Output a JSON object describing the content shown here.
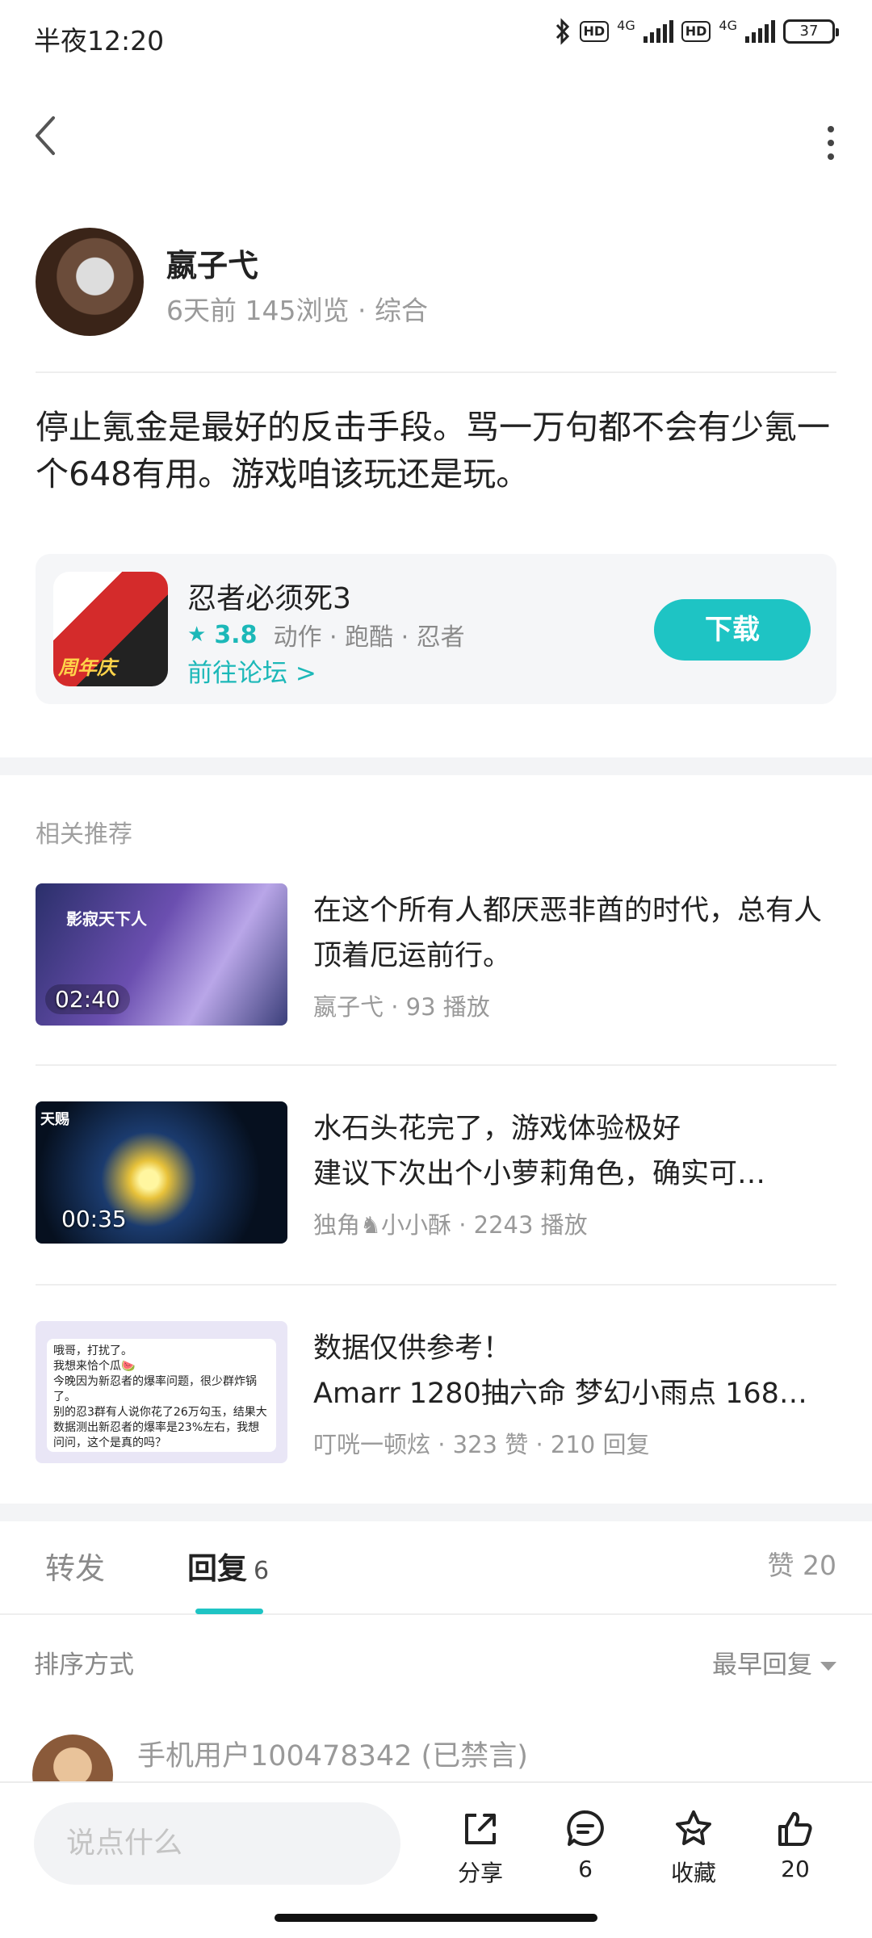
{
  "status_bar": {
    "time": "半夜12:20",
    "hd1": "HD",
    "net1": "4G",
    "hd2": "HD",
    "net2": "4G",
    "battery": "37"
  },
  "author": {
    "name": "嬴子弋",
    "meta": "6天前 145浏览 · 综合"
  },
  "post": {
    "text": "停止氪金是最好的反击手段。骂一万句都不会有少氪一个648有用。游戏咱该玩还是玩。"
  },
  "game_card": {
    "icon_badge": "周年庆",
    "name": "忍者必须死3",
    "rating": "3.8",
    "tags": "动作 · 跑酷 · 忍者",
    "forum_link": "前往论坛 >",
    "download_label": "下载"
  },
  "recommendations": {
    "title": "相关推荐",
    "items": [
      {
        "text": "在这个所有人都厌恶非酋的时代，总有人顶着厄运前行。",
        "meta": "嬴子弋 · 93 播放",
        "duration": "02:40",
        "thumb_title": "影寂天下人"
      },
      {
        "text": "水石头花完了，游戏体验极好\n建议下次出个小萝莉角色，确实可…",
        "meta": "独角♞小小酥 · 2243 播放",
        "duration": "00:35",
        "thumb_title": "天赐"
      },
      {
        "text": "数据仅供参考！\nAmarr 1280抽六命 梦幻小雨点 168…",
        "meta": "叮咣一顿炫 · 323 赞 · 210 回复",
        "duration": "",
        "thumb_title": "哦哥，打扰了。\n我想来恰个瓜🍉\n今晚因为新忍者的爆率问题，很少群炸锅了。\n别的忍3群有人说你花了26万勾玉，结果大数据测出新忍者的爆率是23%左右，我想问问，这个是真的吗？"
      }
    ]
  },
  "tabs": {
    "forward": "转发",
    "reply": "回复",
    "reply_count": "6",
    "likes": "赞 20"
  },
  "sort": {
    "label": "排序方式",
    "value": "最早回复"
  },
  "reply_preview": {
    "user": "手机用户100478342 (已禁言)"
  },
  "bottom_bar": {
    "input_placeholder": "说点什么",
    "share_label": "分享",
    "comment_count": "6",
    "favorite_label": "收藏",
    "like_count": "20"
  }
}
